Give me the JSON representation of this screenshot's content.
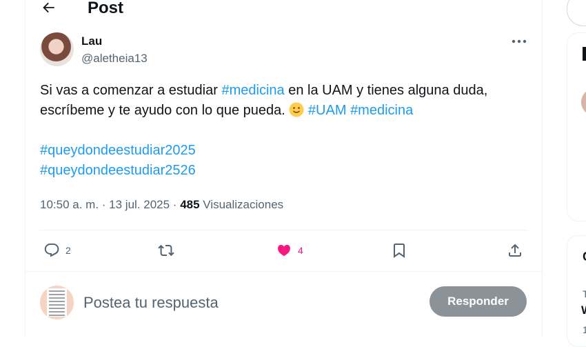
{
  "header": {
    "title": "Post",
    "back_icon": "arrow-left-icon"
  },
  "author": {
    "name": "Lau",
    "handle": "@aletheia13"
  },
  "tweet": {
    "line1": {
      "pre": "Si vas a comenzar a estudiar ",
      "tag1": "#medicina",
      "post": " en la UAM y tienes alguna duda,"
    },
    "line2": {
      "pre": "escríbeme y te ayudo con lo que pueda. ",
      "emoji": "slightly-smiling-face",
      "tag2": "#UAM",
      "tag3": "#medicina"
    },
    "hashtags_block": [
      "#queydondeestudiar2025",
      "#queydondeestudiar2526"
    ]
  },
  "meta": {
    "time": "10:50 a. m.",
    "sep1": " · ",
    "date": "13 jul. 2025",
    "sep2": " · ",
    "views_count": "485",
    "views_label": " Visualizaciones"
  },
  "actions": {
    "reply": {
      "icon": "reply-icon",
      "count": "2"
    },
    "retweet": {
      "icon": "retweet-icon",
      "count": ""
    },
    "like": {
      "icon": "heart-icon",
      "count": "4",
      "color": "#f91880"
    },
    "bookmark": {
      "icon": "bookmark-icon"
    },
    "share": {
      "icon": "share-icon"
    }
  },
  "reply_box": {
    "placeholder": "Postea tu respuesta",
    "button_label": "Responder"
  },
  "colors": {
    "link": "#1d9bf0",
    "muted": "#536471",
    "text": "#0f1419",
    "button": "#8b9298"
  },
  "right_column": {
    "card2_lines": [
      "C",
      "T",
      "W",
      "1"
    ]
  }
}
